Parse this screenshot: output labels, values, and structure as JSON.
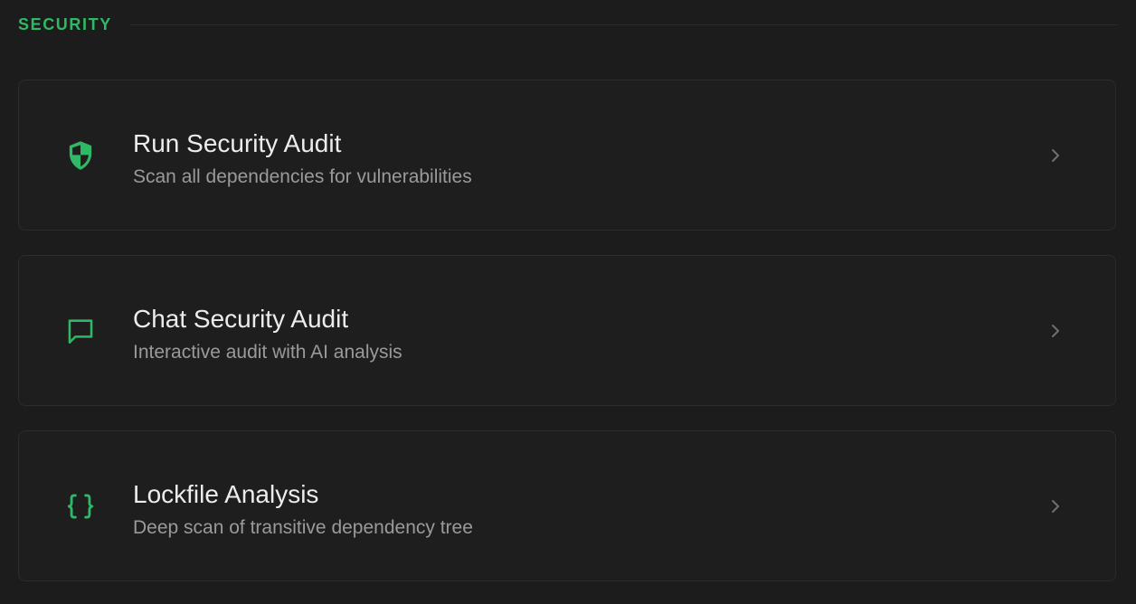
{
  "section": {
    "title": "SECURITY"
  },
  "colors": {
    "accent": "#2fb865",
    "background": "#1c1c1c",
    "card_border": "#2c2c2c"
  },
  "items": [
    {
      "title": "Run Security Audit",
      "subtitle": "Scan all dependencies for vulnerabilities",
      "icon": "shield-icon"
    },
    {
      "title": "Chat Security Audit",
      "subtitle": "Interactive audit with AI analysis",
      "icon": "chat-bubble-icon"
    },
    {
      "title": "Lockfile Analysis",
      "subtitle": "Deep scan of transitive dependency tree",
      "icon": "curly-braces-icon"
    }
  ]
}
